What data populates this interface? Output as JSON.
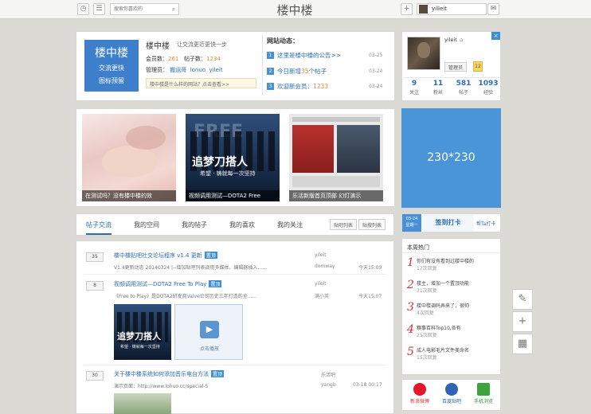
{
  "topbar": {
    "search_placeholder": "搜索你喜欢的",
    "site_title": "楼中楼",
    "username": "yilleit",
    "plus_glyph": "+"
  },
  "intro": {
    "logo_main": "楼中楼",
    "logo_sub1": "交流更快",
    "logo_sub2": "图标预留",
    "name": "楼中楼",
    "slogan": "让交流更近更快一步",
    "members_label": "会员数：",
    "members": "261",
    "posts_label": "帖子数：",
    "posts": "1234",
    "admins_label": "管理员：",
    "admin1": "搬运哥",
    "admin2": "lonuo",
    "admin3": "yileit",
    "notice": "楼中楼是什么样的网站？点击查看>>"
  },
  "news": {
    "title": "网站动态：",
    "items": [
      {
        "num": "1",
        "text": "这里是楼中楼的公告>>",
        "date": "03-25"
      },
      {
        "num": "2",
        "pre": "今日新增",
        "count": "35",
        "post": "个帖子",
        "date": "03-24"
      },
      {
        "num": "3",
        "pre": "欢迎新会员：",
        "count": "1233",
        "date": "03-24"
      }
    ]
  },
  "profile": {
    "name": "yileit",
    "role": "管理员",
    "level": "12",
    "stats": [
      {
        "n": "9",
        "l": "关注"
      },
      {
        "n": "11",
        "l": "粉丝"
      },
      {
        "n": "581",
        "l": "帖子"
      },
      {
        "n": "1093",
        "l": "经验"
      }
    ]
  },
  "slides": [
    {
      "caption": "在测试吗？没有楼中楼的效"
    },
    {
      "caption": "视频调用测试—DOTA2 Free",
      "main": "追梦刀搭人",
      "sub": "希望 · 铸就每一次坚持",
      "banner": "FREE"
    },
    {
      "caption": "乐活新版首页顶部 幻灯演示"
    }
  ],
  "ad": {
    "label": "230*230"
  },
  "tabs": {
    "items": [
      "帖子交流",
      "我的空间",
      "我的帖子",
      "我的喜欢",
      "我的关注"
    ],
    "view_list": "贴吧列表",
    "view_grid": "贴搜列表"
  },
  "posts": [
    {
      "count": "35",
      "title": "楼中楼贴吧社交论坛程序 v1.4 更新",
      "tag": "置顶",
      "desc": "V1.4更新动态 20140324 |--增加贴吧列表调用多媒体，编辑器插入……",
      "author": "yileit",
      "last": "domway",
      "time": "今天15:09"
    },
    {
      "count": "8",
      "title": "视频调用测试—DOTA2 Free To Play",
      "tag": "置顶",
      "desc": "《Free to Play》是DOTA2研发商Valve公司历史三年打造的全……",
      "author": "yileit",
      "last": "满小英",
      "time": "今天15:07",
      "thumb_main": "追梦刀搭人",
      "thumb_sub": "希望 · 铸就每一次坚持",
      "play_label": "点击播放"
    },
    {
      "count": "30",
      "title": "关于楼中楼系统如何添加音乐电台方法",
      "tag": "置顶",
      "desc": "演示页面：http://www.lohuo.cc/special-5",
      "author": "乐活吧",
      "last": "yangb",
      "time": "03-18 00:17"
    }
  ],
  "signin": {
    "date": "03-24",
    "weekday": "星期一",
    "button": "签到打卡",
    "link": "帮Ta打卡"
  },
  "hot": {
    "title": "本周热门",
    "items": [
      {
        "num": "1",
        "text": "你们有没有看到过楼中楼的",
        "sub": "17次回复"
      },
      {
        "num": "2",
        "text": "楼主，增加一个置顶功能",
        "sub": "31次回复"
      },
      {
        "num": "3",
        "text": "楼中楼调码弄来了，很帅",
        "sub": "4次回复"
      },
      {
        "num": "4",
        "text": "糗事百科Top10,各有",
        "sub": "25次回复"
      },
      {
        "num": "5",
        "text": "成人电影毛片文件美命名",
        "sub": "15次回复"
      }
    ]
  },
  "share": {
    "items": [
      "新浪微博",
      "百度贴吧",
      "手机浏览"
    ]
  },
  "tools": {
    "items": [
      "✎",
      "+",
      "▦"
    ]
  },
  "colors": {
    "accent": "#2b6cb5",
    "brand_blue": "#3d7fcb",
    "ad_blue": "#4a94d8",
    "orange": "#e08a3c",
    "hot_red": "#cc3333"
  }
}
